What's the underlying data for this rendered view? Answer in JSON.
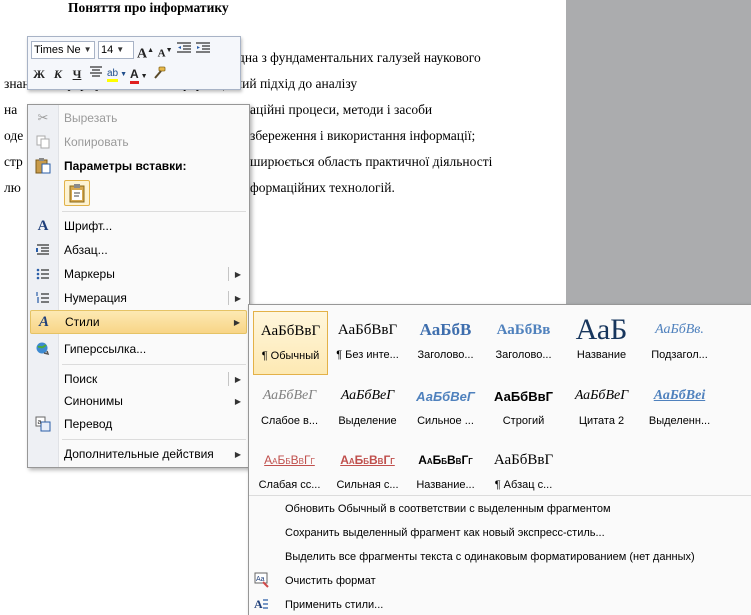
{
  "document": {
    "title": "Поняття про інформатику",
    "lines": [
      "дна з фундаментальних галузей наукового",
      "знань, яка формує системно-інформаційний підхід до аналізу",
      "на",
      "аційні процеси, методи і засоби",
      "оде",
      "збереження і використання інформації;",
      "стр",
      "ширюється область практичної діяльності",
      "лю",
      "формаційних технологій."
    ]
  },
  "mini_toolbar": {
    "font_name": "Times Ne",
    "font_size": "14",
    "grow": "A",
    "shrink": "A",
    "bold": "Ж",
    "italic": "К",
    "underline": "Ч",
    "highlight": "ab",
    "font_color": "A"
  },
  "context_menu": {
    "cut": "Вырезать",
    "copy": "Копировать",
    "paste_options": "Параметры вставки:",
    "font": "Шрифт...",
    "paragraph": "Абзац...",
    "bullets": "Маркеры",
    "numbering": "Нумерация",
    "styles": "Стили",
    "hyperlink": "Гиперссылка...",
    "search": "Поиск",
    "synonyms": "Синонимы",
    "translate": "Перевод",
    "more_actions": "Дополнительные действия"
  },
  "styles_gallery": {
    "tiles": [
      {
        "sample": "АаБбВвГ",
        "caption": "¶ Обычный"
      },
      {
        "sample": "АаБбВвГ",
        "caption": "¶ Без инте..."
      },
      {
        "sample": "АаБбВ",
        "caption": "Заголово..."
      },
      {
        "sample": "АаБбВв",
        "caption": "Заголово..."
      },
      {
        "sample": "АаБ",
        "caption": "Название"
      },
      {
        "sample": "АаБбВв.",
        "caption": "Подзагол..."
      },
      {
        "sample": "АаБбВеГ",
        "caption": "Слабое в..."
      },
      {
        "sample": "АаБбВеГ",
        "caption": "Выделение"
      },
      {
        "sample": "АаБбВеГ",
        "caption": "Сильное ..."
      },
      {
        "sample": "АаБбВвГ",
        "caption": "Строгий"
      },
      {
        "sample": "АаБбВеГ",
        "caption": "Цитата 2"
      },
      {
        "sample": "АаБбВеі",
        "caption": "Выделенн..."
      },
      {
        "sample": "АаБбВвГг",
        "caption": "Слабая сс..."
      },
      {
        "sample": "АаБбВвГг",
        "caption": "Сильная с..."
      },
      {
        "sample": "АаБбВвГг",
        "caption": "Название..."
      },
      {
        "sample": "АаБбВвГ",
        "caption": "¶ Абзац с..."
      }
    ],
    "commands": [
      "Обновить Обычный в соответствии с выделенным фрагментом",
      "Сохранить выделенный фрагмент как новый экспресс-стиль...",
      "Выделить все фрагменты текста с одинаковым форматированием (нет данных)",
      "Очистить формат",
      "Применить стили..."
    ]
  },
  "colors": {
    "highlight_fill": "#fde9b3",
    "heading_blue": "#3e6ead",
    "accent_red": "#c0504d",
    "font_color_red": "#e02020"
  }
}
